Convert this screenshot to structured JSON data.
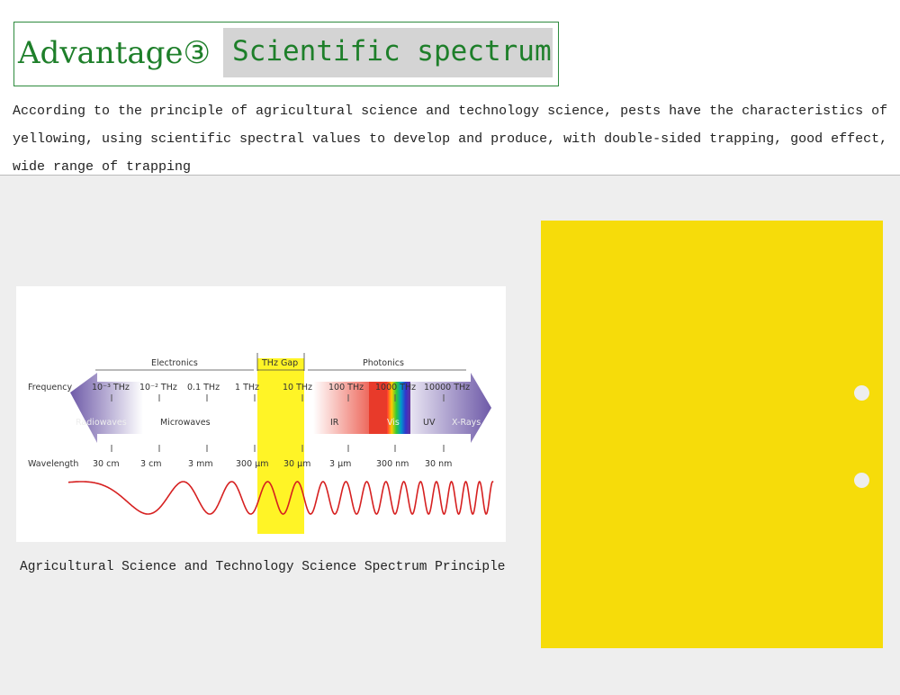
{
  "header": {
    "title_prefix": "Advantage③",
    "title_highlight": "Scientific spectrum",
    "description": "According to the principle of agricultural science and technology science, pests have the characteristics of yellowing, using scientific spectral values to develop and produce, with double-sided trapping, good effect, wide range of trapping"
  },
  "diagram": {
    "regions": {
      "electronics": "Electronics",
      "thz_gap": "THz Gap",
      "photonics": "Photonics"
    },
    "frequency_label": "Frequency",
    "frequencies": [
      "10⁻³ THz",
      "10⁻² THz",
      "0.1 THz",
      "1 THz",
      "10 THz",
      "100 THz",
      "1000 THz",
      "10000 THz"
    ],
    "bands": [
      "Radiowaves",
      "Microwaves",
      "IR",
      "Vis",
      "UV",
      "X-Rays"
    ],
    "wavelength_label": "Wavelength",
    "wavelengths": [
      "30 cm",
      "3 cm",
      "3 mm",
      "300 µm",
      "30 µm",
      "3 µm",
      "300 nm",
      "30 nm"
    ],
    "highlight_color": "#fff200",
    "wave_color": "#d62020",
    "caption": "Agricultural Science and Technology Science Spectrum Principle"
  },
  "product": {
    "color": "#f6dc0a"
  }
}
